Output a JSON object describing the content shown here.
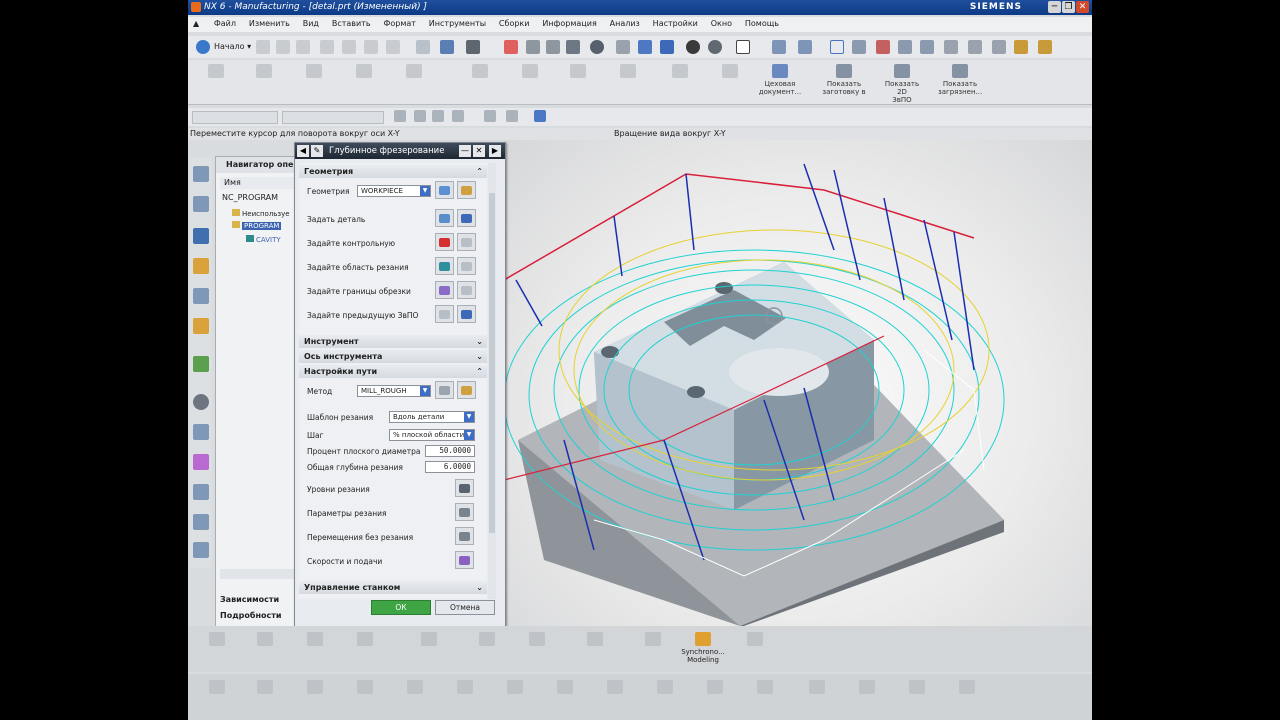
{
  "window": {
    "title": "NX 6 - Manufacturing - [detal.prt (Измененный) ]",
    "brand": "SIEMENS",
    "min": "─",
    "restore": "❐",
    "close": "✕"
  },
  "menu": [
    "Файл",
    "Изменить",
    "Вид",
    "Вставить",
    "Формат",
    "Инструменты",
    "Сборки",
    "Информация",
    "Анализ",
    "Настройки",
    "Окно",
    "Помощь"
  ],
  "toolbar": {
    "start_label": "Начало ▾"
  },
  "ribbon": {
    "workshop_doc": [
      "Цеховая",
      "документ..."
    ],
    "show_blank": [
      "Показать",
      "заготовку в"
    ],
    "show_2d": [
      "Показать 2D",
      "ЗвПО"
    ],
    "show_loaded": [
      "Показать",
      "загрязнен..."
    ]
  },
  "status": {
    "hint": "Переместите курсор для поворота вокруг оси X-Y",
    "mode": "Вращение вида вокруг X-Y"
  },
  "navigator": {
    "title": "Навигатор опе",
    "column": "Имя",
    "root": "NC_PROGRAM",
    "unused": "Неиспользуе",
    "program": "PROGRAM",
    "op": "CAVITY",
    "dependencies": "Зависимости",
    "details": "Подробности"
  },
  "dialog": {
    "title": "Глубинное фрезерование",
    "geometry": {
      "header": "Геометрия",
      "geometry_label": "Геометрия",
      "geometry_value": "WORKPIECE",
      "set_part": "Задать деталь",
      "set_check": "Задайте контрольную",
      "set_cut_area": "Задайте область резания",
      "set_trim": "Задайте границы обрезки",
      "set_prev": "Задайте предыдущую ЗвПО"
    },
    "tool_header": "Инструмент",
    "axis_header": "Ось инструмента",
    "path": {
      "header": "Настройки пути",
      "method_label": "Метод",
      "method_value": "MILL_ROUGH",
      "pattern_label": "Шаблон резания",
      "pattern_value": "Вдоль детали",
      "step_label": "Шаг",
      "step_value": "% плоской области",
      "percent_label": "Процент плоского диаметра",
      "percent_value": "50.0000",
      "depth_label": "Общая глубина резания",
      "depth_value": "6.0000",
      "levels": "Уровни резания",
      "params": "Параметры резания",
      "noncut": "Перемещения без резания",
      "feeds": "Скорости и подачи"
    },
    "machine_header": "Управление станком",
    "ok": "ОК",
    "cancel": "Отмена"
  },
  "bottom": {
    "synchro": [
      "Synchrono...",
      "Modeling"
    ]
  }
}
